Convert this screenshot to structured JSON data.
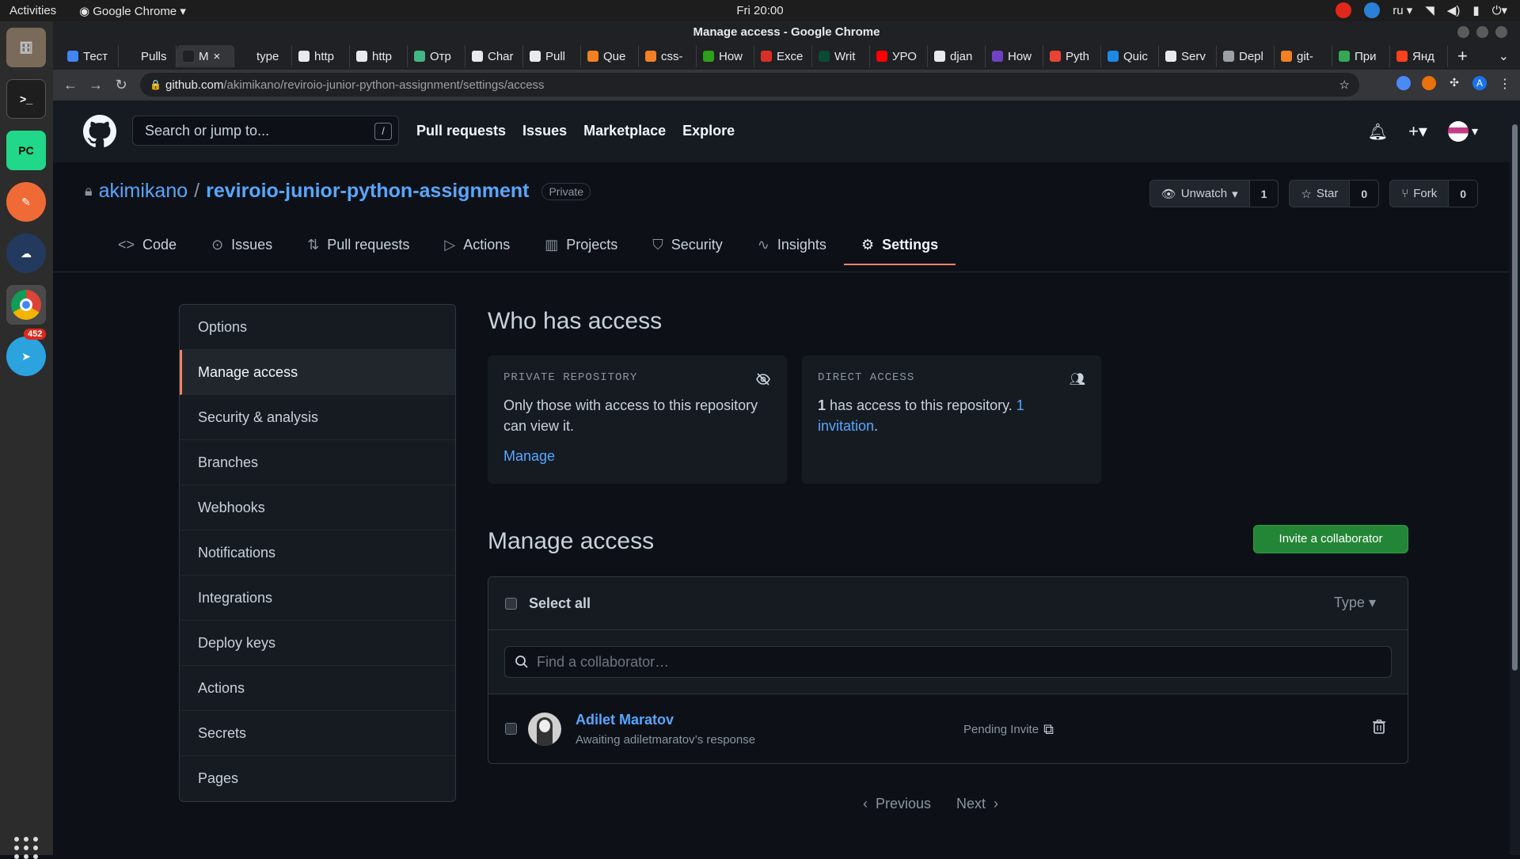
{
  "os": {
    "activities": "Activities",
    "app_name": "Google Chrome",
    "clock": "Fri 20:00",
    "lang": "ru",
    "dock_badge": "452"
  },
  "browser": {
    "window_title": "Manage access - Google Chrome",
    "tabs": [
      {
        "label": "Тест",
        "color": "#4285f4"
      },
      {
        "label": "Pulls",
        "color": "#202124"
      },
      {
        "label": "M",
        "color": "#202124"
      },
      {
        "label": "type",
        "color": "#202124"
      },
      {
        "label": "http",
        "color": "#e8eaed"
      },
      {
        "label": "http",
        "color": "#e8eaed"
      },
      {
        "label": "Отр",
        "color": "#41b883"
      },
      {
        "label": "Char",
        "color": "#e8eaed"
      },
      {
        "label": "Pull",
        "color": "#e8eaed"
      },
      {
        "label": "Que",
        "color": "#f48024"
      },
      {
        "label": "css-",
        "color": "#f48024"
      },
      {
        "label": "How",
        "color": "#2ca01c"
      },
      {
        "label": "Exce",
        "color": "#d93025"
      },
      {
        "label": "Writ",
        "color": "#0c4b33"
      },
      {
        "label": "УРО",
        "color": "#ff0000"
      },
      {
        "label": "djan",
        "color": "#e8eaed"
      },
      {
        "label": "How",
        "color": "#6f42c1"
      },
      {
        "label": "Pyth",
        "color": "#ea4335"
      },
      {
        "label": "Quic",
        "color": "#1e88e5"
      },
      {
        "label": "Serv",
        "color": "#e8eaed"
      },
      {
        "label": "Depl",
        "color": "#9aa0a6"
      },
      {
        "label": "git-",
        "color": "#f48024"
      },
      {
        "label": "При",
        "color": "#34a853"
      },
      {
        "label": "Янд",
        "color": "#fc3f1d"
      }
    ],
    "url_host": "github.com",
    "url_path": "/akimikano/reviroio-junior-python-assignment/settings/access",
    "profile_letter": "A"
  },
  "gh": {
    "search_placeholder": "Search or jump to...",
    "search_key": "/",
    "nav": [
      "Pull requests",
      "Issues",
      "Marketplace",
      "Explore"
    ],
    "owner": "akimikano",
    "sep": "/",
    "repo": "reviroio-junior-python-assignment",
    "visibility": "Private",
    "unwatch": "Unwatch",
    "watch_count": "1",
    "star": "Star",
    "star_count": "0",
    "fork": "Fork",
    "fork_count": "0",
    "repo_tabs": [
      "Code",
      "Issues",
      "Pull requests",
      "Actions",
      "Projects",
      "Security",
      "Insights",
      "Settings"
    ],
    "side": [
      "Options",
      "Manage access",
      "Security & analysis",
      "Branches",
      "Webhooks",
      "Notifications",
      "Integrations",
      "Deploy keys",
      "Actions",
      "Secrets",
      "Pages"
    ],
    "who_title": "Who has access",
    "card1": {
      "title": "PRIVATE REPOSITORY",
      "text": "Only those with access to this repository can view it.",
      "link": "Manage"
    },
    "card2": {
      "title": "DIRECT ACCESS",
      "count": "1",
      "text": " has access to this repository. ",
      "link": "1 invitation",
      "tail": "."
    },
    "manage_title": "Manage access",
    "invite_btn": "Invite a collaborator",
    "select_all": "Select all",
    "type_filter": "Type",
    "find_placeholder": "Find a collaborator…",
    "collab": {
      "name": "Adilet Maratov",
      "sub": "Awaiting adiletmaratov’s response",
      "status": "Pending Invite"
    },
    "prev": "Previous",
    "next": "Next",
    "accent": "#f78166",
    "link_color": "#58a6ff",
    "green": "#238636"
  }
}
